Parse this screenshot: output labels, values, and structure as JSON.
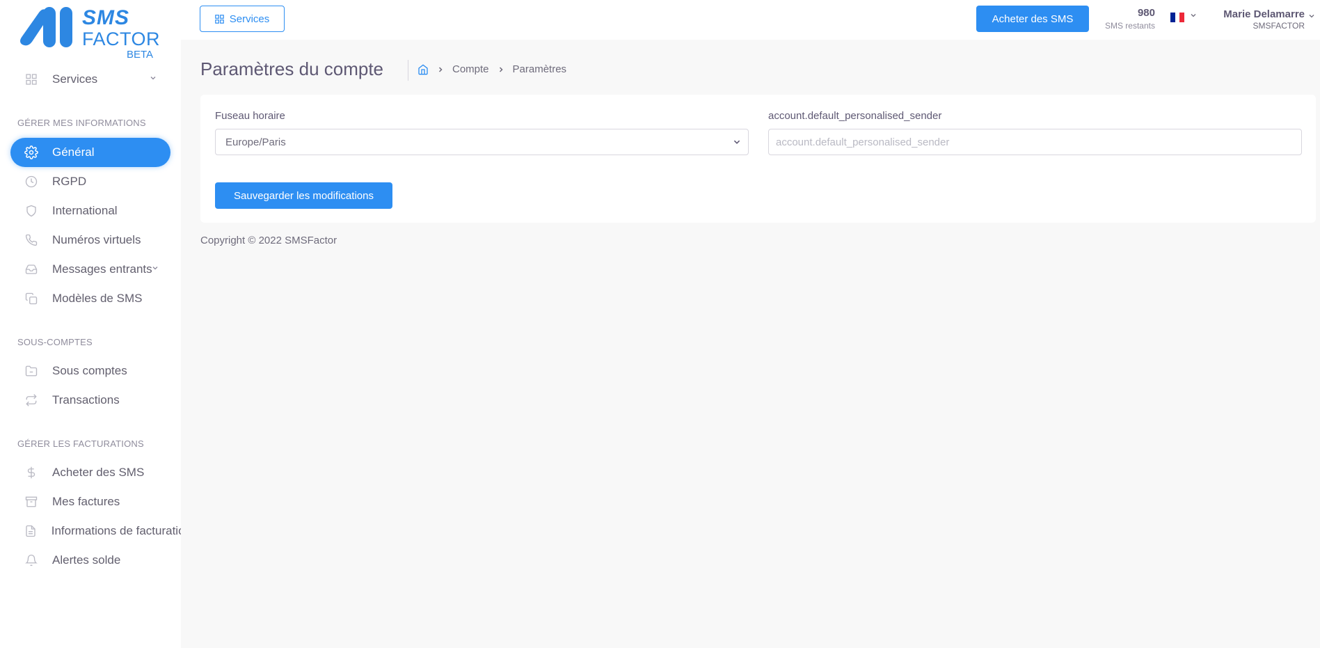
{
  "brand": {
    "line1": "SMS",
    "line2": "FACTOR",
    "badge": "BETA",
    "color": "#2d87e2"
  },
  "topbar": {
    "services_label": "Services",
    "buy_label": "Acheter des SMS",
    "credits_value": "980",
    "credits_label": "SMS restants",
    "language": "fr",
    "user_name": "Marie Delamarre",
    "user_org": "SMSFACTOR"
  },
  "sidebar": {
    "services_label": "Services",
    "section_info": "GÉRER MES INFORMATIONS",
    "info_items": [
      {
        "label": "Général",
        "icon": "gear-icon",
        "active": true
      },
      {
        "label": "RGPD",
        "icon": "clock-icon"
      },
      {
        "label": "International",
        "icon": "shield-icon"
      },
      {
        "label": "Numéros virtuels",
        "icon": "phone-icon"
      },
      {
        "label": "Messages entrants",
        "icon": "inbox-icon"
      },
      {
        "label": "Modèles de SMS",
        "icon": "copy-icon"
      }
    ],
    "section_sub": "SOUS-COMPTES",
    "sub_items": [
      {
        "label": "Sous comptes",
        "icon": "folder-icon"
      },
      {
        "label": "Transactions",
        "icon": "repeat-icon"
      }
    ],
    "section_billing": "GÉRER LES FACTURATIONS",
    "billing_items": [
      {
        "label": "Acheter des SMS",
        "icon": "dollar-icon"
      },
      {
        "label": "Mes factures",
        "icon": "archive-icon"
      },
      {
        "label": "Informations de facturation",
        "icon": "file-icon"
      },
      {
        "label": "Alertes solde",
        "icon": "bell-icon"
      }
    ]
  },
  "header": {
    "title": "Paramètres du compte",
    "breadcrumb": [
      "Compte",
      "Paramètres"
    ]
  },
  "form": {
    "timezone_label": "Fuseau horaire",
    "timezone_value": "Europe/Paris",
    "sender_label": "account.default_personalised_sender",
    "sender_placeholder": "account.default_personalised_sender",
    "sender_value": "",
    "save_label": "Sauvegarder les modifications"
  },
  "footer": {
    "copyright": "Copyright © 2022 SMSFactor"
  },
  "colors": {
    "primary": "#2d8ef2",
    "background": "#f8f8f8",
    "text": "#5e5873"
  }
}
